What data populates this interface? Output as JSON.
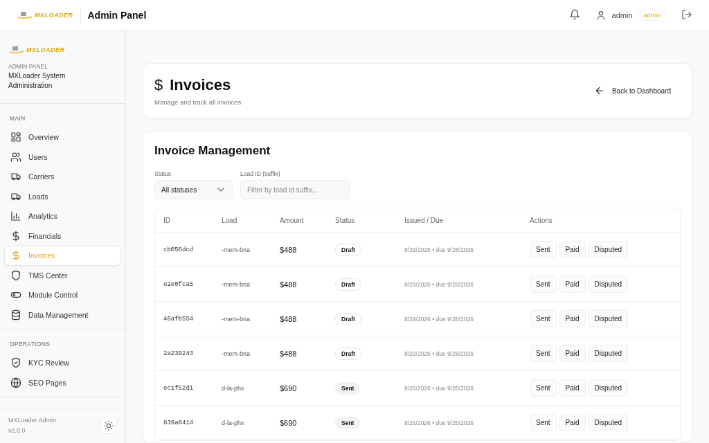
{
  "topbar": {
    "logo": "MXLOADER",
    "title": "Admin Panel",
    "user": "admin",
    "role": "admin"
  },
  "sidebar": {
    "logo": "MXLOADER",
    "caption": "ADMIN PANEL",
    "subtitle": "MXLoader System Administration",
    "sections": [
      {
        "title": "MAIN",
        "items": [
          {
            "label": "Overview",
            "selected": false
          },
          {
            "label": "Users",
            "selected": false
          },
          {
            "label": "Carriers",
            "selected": false
          },
          {
            "label": "Loads",
            "selected": false
          },
          {
            "label": "Analytics",
            "selected": false
          },
          {
            "label": "Financials",
            "selected": false
          },
          {
            "label": "Invoices",
            "selected": true
          },
          {
            "label": "TMS Center",
            "selected": false
          },
          {
            "label": "Module Control",
            "selected": false
          },
          {
            "label": "Data Management",
            "selected": false
          }
        ]
      },
      {
        "title": "OPERATIONS",
        "items": [
          {
            "label": "KYC Review",
            "selected": false
          },
          {
            "label": "SEO Pages",
            "selected": false
          }
        ]
      }
    ],
    "footer": {
      "name": "MXLoader Admin",
      "version": "v2.0.0"
    }
  },
  "page_header": {
    "icon": "$",
    "title": "Invoices",
    "subtitle": "Manage and track all invoices",
    "back": "Back to Dashboard"
  },
  "management": {
    "title": "Invoice Management",
    "filters": {
      "status_label": "Status",
      "status_value": "All statuses",
      "load_label": "Load ID (suffix)",
      "load_placeholder": "Filter by load id suffix..."
    },
    "table": {
      "columns": [
        "ID",
        "Load",
        "Amount",
        "Status",
        "Issued / Due",
        "Actions"
      ],
      "rows": [
        {
          "id": "cb056dcd",
          "load": "-mem-bna",
          "amount": "$488",
          "status": "Draft",
          "kind": "draft",
          "dates": "8/29/2026 • due 9/28/2026",
          "actions": [
            "Sent",
            "Paid",
            "Disputed"
          ]
        },
        {
          "id": "e2e0fca5",
          "load": "-mem-bna",
          "amount": "$488",
          "status": "Draft",
          "kind": "draft",
          "dates": "8/29/2026 • due 9/28/2026",
          "actions": [
            "Sent",
            "Paid",
            "Disputed"
          ]
        },
        {
          "id": "46afb554",
          "load": "-mem-bna",
          "amount": "$488",
          "status": "Draft",
          "kind": "draft",
          "dates": "8/29/2026 • due 9/28/2026",
          "actions": [
            "Sent",
            "Paid",
            "Disputed"
          ]
        },
        {
          "id": "2a239243",
          "load": "-mem-bna",
          "amount": "$488",
          "status": "Draft",
          "kind": "draft",
          "dates": "8/29/2026 • due 9/28/2026",
          "actions": [
            "Sent",
            "Paid",
            "Disputed"
          ]
        },
        {
          "id": "ec1f52d1",
          "load": "d-la-phx",
          "amount": "$690",
          "status": "Sent",
          "kind": "sent",
          "dates": "8/26/2026 • due 9/25/2026",
          "actions": [
            "Sent",
            "Paid",
            "Disputed"
          ]
        },
        {
          "id": "839a8414",
          "load": "d-la-phx",
          "amount": "$690",
          "status": "Sent",
          "kind": "sent",
          "dates": "8/26/2026 • due 9/25/2026",
          "actions": [
            "Sent",
            "Paid",
            "Disputed"
          ]
        }
      ]
    }
  }
}
